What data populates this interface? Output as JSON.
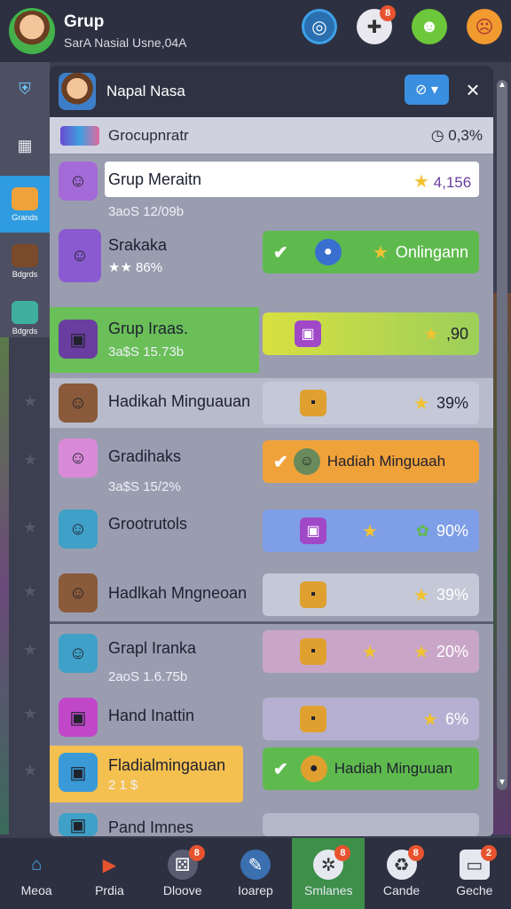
{
  "header": {
    "title": "Grup",
    "subtitle": "SarA Nasial Usne,04A",
    "icons": [
      {
        "name": "target-icon",
        "badge": ""
      },
      {
        "name": "gamepad-icon",
        "badge": "8"
      },
      {
        "name": "smile-star-icon",
        "badge": ""
      },
      {
        "name": "sad-face-icon",
        "badge": ""
      }
    ]
  },
  "sidebar": {
    "items": [
      {
        "label": "",
        "icon": "shield-icon"
      },
      {
        "label": "",
        "icon": "grid-icon"
      },
      {
        "label": "Grands",
        "icon": "treasure-icon",
        "active": true
      },
      {
        "label": "Bdgrds",
        "icon": "hero-icon"
      },
      {
        "label": "Bdgrds",
        "icon": "fish-icon"
      }
    ]
  },
  "panel": {
    "name": "Napal Nasa",
    "subheader_title": "Grocupnratr",
    "subheader_value": "0,3%"
  },
  "rows": [
    {
      "name": "Grup Meraitn",
      "sub": "3aoS 12/09b",
      "bar_value": "4,156",
      "bar_label": "",
      "bar_color": "#ffffff"
    },
    {
      "name": "Srakaka",
      "sub": "★★ 86%",
      "bar_value": "",
      "bar_label": "Onlingann",
      "bar_color": "#5fba4e"
    },
    {
      "name": "Grup Iraas.",
      "sub": "3a$S 15.73b",
      "bar_value": ",90",
      "bar_label": "",
      "bar_color": "#c8d850"
    },
    {
      "name": "Hadikah Minguauan",
      "sub": "",
      "bar_value": "39%",
      "bar_label": "",
      "bar_color": "#c5c8d6"
    },
    {
      "name": "Gradihaks",
      "sub": "3a$S 15/2%",
      "bar_value": "",
      "bar_label": "Hadiah Minguaah",
      "bar_color": "#f0a23a"
    },
    {
      "name": "Grootrutols",
      "sub": "",
      "bar_value": "90%",
      "bar_label": "",
      "bar_color": "#7e9ee8"
    },
    {
      "name": "Hadlkah Mngneoan",
      "sub": "",
      "bar_value": "39%",
      "bar_label": "",
      "bar_color": "#c5c8d6"
    },
    {
      "name": "Grapl Iranka",
      "sub": "2aoS 1.6.75b",
      "bar_value": "20%",
      "bar_label": "",
      "bar_color": "#c9a6c8"
    },
    {
      "name": "Hand Inattin",
      "sub": "",
      "bar_value": "6%",
      "bar_label": "",
      "bar_color": "#b5b0d2"
    },
    {
      "name": "Fladialmingauan",
      "sub": "2 1 $",
      "bar_value": "",
      "bar_label": "Hadiah Minguuan",
      "bar_color": "#5fba4e"
    },
    {
      "name": "Pand Imnes",
      "sub": "",
      "bar_value": "",
      "bar_label": "",
      "bar_color": "#b5b8c8"
    }
  ],
  "nav": [
    {
      "label": "Meoa",
      "icon": "home-icon",
      "badge": ""
    },
    {
      "label": "Prdia",
      "icon": "play-icon",
      "badge": ""
    },
    {
      "label": "Dloove",
      "icon": "dice-icon",
      "badge": "8"
    },
    {
      "label": "Ioarep",
      "icon": "compass-icon",
      "badge": ""
    },
    {
      "label": "Smlanes",
      "icon": "puzzle-icon",
      "badge": "8",
      "active": true
    },
    {
      "label": "Cande",
      "icon": "recycle-icon",
      "badge": "8"
    },
    {
      "label": "Geche",
      "icon": "chat-icon",
      "badge": "2"
    }
  ],
  "colors": {
    "accent_blue": "#2f9be0",
    "accent_green": "#5fba4e",
    "accent_orange": "#f0a23a",
    "badge_red": "#e8532f"
  }
}
